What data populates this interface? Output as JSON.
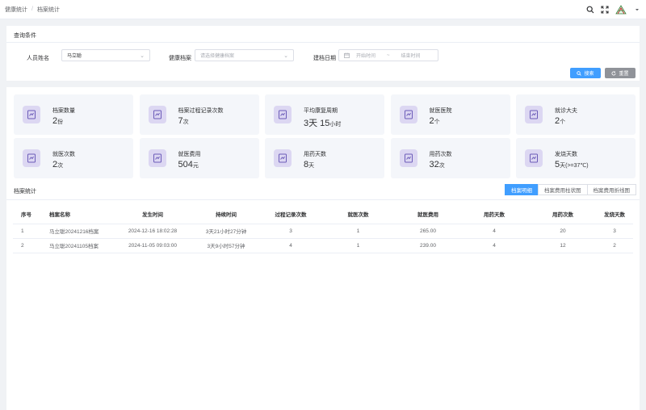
{
  "breadcrumb": {
    "home": "健康统计",
    "separator": "/",
    "current": "档案统计"
  },
  "topbar": {
    "icons": [
      "search-icon",
      "fullscreen-icon",
      "app-logo",
      "chevron-down-icon"
    ]
  },
  "query": {
    "title": "查询条件",
    "person_label": "人员姓名",
    "person_value": "马立聪",
    "record_label": "健康档案",
    "record_placeholder": "请选择健康档案",
    "date_label": "建档日期",
    "start_placeholder": "开始时间",
    "date_sep": "~",
    "end_placeholder": "结束时间",
    "search_label": "搜索",
    "reset_label": "重置"
  },
  "stats": [
    {
      "label": "档案数量",
      "value": "2",
      "unit": "份"
    },
    {
      "label": "档案过程记录次数",
      "value": "7",
      "unit": "次"
    },
    {
      "label": "平均康复周期",
      "value": "3天 15",
      "unit": "小时"
    },
    {
      "label": "就医医院",
      "value": "2",
      "unit": "个"
    },
    {
      "label": "就诊大夫",
      "value": "2",
      "unit": "个"
    },
    {
      "label": "就医次数",
      "value": "2",
      "unit": "次"
    },
    {
      "label": "就医费用",
      "value": "504",
      "unit": "元"
    },
    {
      "label": "用药天数",
      "value": "8",
      "unit": "天"
    },
    {
      "label": "用药次数",
      "value": "32",
      "unit": "次"
    },
    {
      "label": "发烧天数",
      "value": "5",
      "unit": "天(>=37℃)"
    }
  ],
  "section": {
    "title": "档案统计",
    "tabs": [
      "档案明细",
      "档案费用柱状图",
      "档案费用折线图"
    ],
    "active_tab": "档案明细"
  },
  "table": {
    "headers": [
      "序号",
      "档案名称",
      "发生时间",
      "持续时间",
      "过程记录次数",
      "就医次数",
      "就医费用",
      "用药天数",
      "用药次数",
      "发烧天数"
    ],
    "rows": [
      [
        "1",
        "马立聪20241216档案",
        "2024-12-16 18:02:28",
        "3天21小时27分钟",
        "3",
        "1",
        "265.00",
        "4",
        "20",
        "3"
      ],
      [
        "2",
        "马立聪20241105档案",
        "2024-11-05 09:03:00",
        "3天9小时57分钟",
        "4",
        "1",
        "239.00",
        "4",
        "12",
        "2"
      ]
    ]
  },
  "colors": {
    "primary": "#409eff",
    "reset": "#909399",
    "card_bg": "#f4f6fa",
    "icon_bg": "#dcd7f2"
  }
}
